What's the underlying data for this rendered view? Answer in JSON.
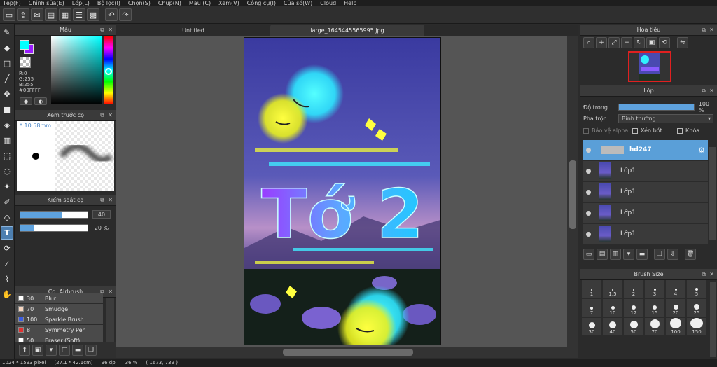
{
  "menu": [
    "Tệp(F)",
    "Chỉnh sửa(E)",
    "Lớp(L)",
    "Bộ lọc(I)",
    "Chọn(S)",
    "Chụp(N)",
    "Màu (C)",
    "Xem(V)",
    "Công cụ(I)",
    "Cửa sổ(W)",
    "Cloud",
    "Help"
  ],
  "tabs": {
    "untitled": "Untitled",
    "image": "large_1645445565995.jpg"
  },
  "color_panel": {
    "title": "Màu",
    "r": "R:0",
    "g": "G:255",
    "b": "B:255",
    "hex": "#00FFFF",
    "fg_color": "#00ffff",
    "bg_color": "#9b1cff"
  },
  "brush_preview": {
    "title": "Xem trước cọ",
    "size": "10.58mm"
  },
  "brush_control": {
    "title": "Kiểm soát cọ",
    "size_value": "40",
    "opacity_value": "20 %",
    "size_fraction": 0.63,
    "opacity_fraction": 0.2
  },
  "brush_list": {
    "title": "Cọ: Airbrush",
    "items": [
      {
        "size": "30",
        "name": "Blur",
        "swatch": "#ffffff"
      },
      {
        "size": "70",
        "name": "Smudge",
        "swatch": "#f6d6c0"
      },
      {
        "size": "100",
        "name": "Sparkle Brush",
        "swatch": "#3a5be0"
      },
      {
        "size": "8",
        "name": "Symmetry Pen",
        "swatch": "#e03030"
      },
      {
        "size": "50",
        "name": "Eraser (Soft)",
        "swatch": "#ffffff"
      }
    ]
  },
  "navigator": {
    "title": "Hoa tiêu"
  },
  "layer_panel": {
    "title": "Lớp",
    "opacity_label": "Độ trong",
    "opacity_value": "100 %",
    "opacity_fraction": 1.0,
    "blend_label": "Pha trộn",
    "blend_value": "Bình thường",
    "protect_alpha": "Bảo vệ alpha",
    "clipping": "Xén bớt",
    "lock": "Khóa",
    "layers": [
      {
        "name": "hd247",
        "selected": true
      },
      {
        "name": "Lớp1",
        "selected": false
      },
      {
        "name": "Lớp1",
        "selected": false
      },
      {
        "name": "Lớp1",
        "selected": false
      },
      {
        "name": "Lớp1",
        "selected": false
      }
    ]
  },
  "brush_size": {
    "title": "Brush Size",
    "sizes": [
      "1",
      "1.5",
      "2",
      "3",
      "4",
      "5",
      "7",
      "10",
      "12",
      "15",
      "20",
      "25",
      "30",
      "40",
      "50",
      "70",
      "100",
      "150"
    ]
  },
  "status": {
    "dims": "1024 * 1593 pixel",
    "phys": "(27.1 * 42.1cm)",
    "dpi": "96 dpi",
    "zoom": "36 %",
    "coords": "( 1673, 739 )"
  },
  "artwork": {
    "text": "Tớ 2"
  }
}
